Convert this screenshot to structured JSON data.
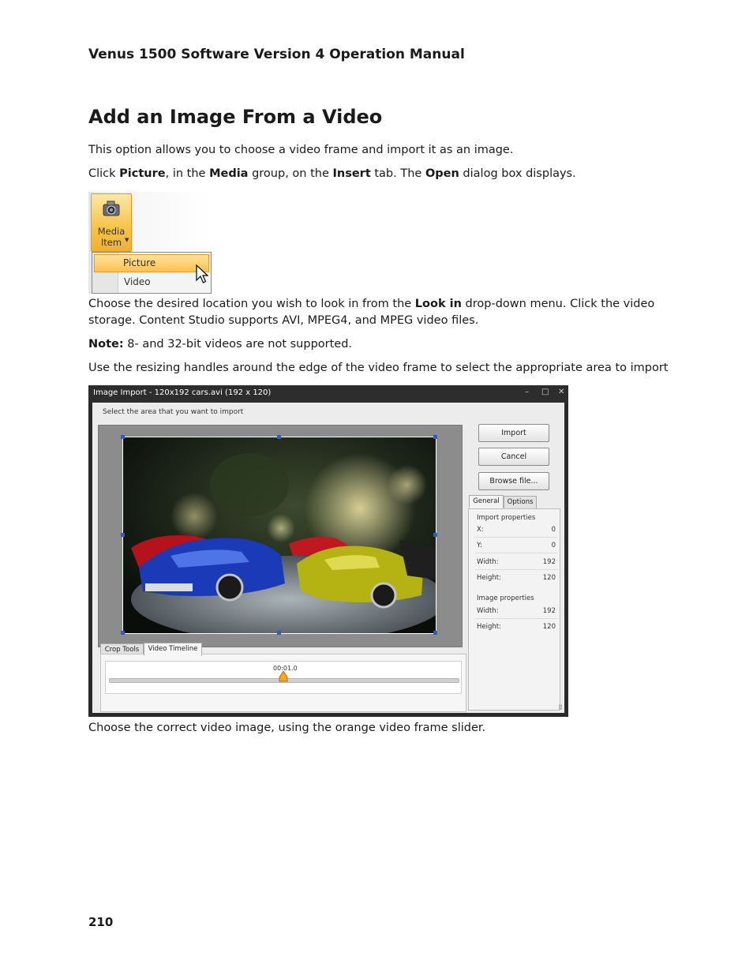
{
  "header": {
    "title": "Venus 1500 Software Version 4 Operation Manual"
  },
  "section": {
    "title": "Add an Image From a Video"
  },
  "body": {
    "p1": "This option allows you to choose a video frame and import it as an image.",
    "p2": {
      "t1": "Click ",
      "b1": "Picture",
      "t2": ", in the ",
      "b2": "Media",
      "t3": " group, on the ",
      "b3": "Insert",
      "t4": " tab. The ",
      "b4": "Open",
      "t5": " dialog box displays."
    },
    "p3": {
      "t1": "Choose the desired location you wish to look in from the ",
      "b1": "Look in",
      "t2": " drop-down menu. Click the video storage. Content Studio supports AVI, MPEG4, and MPEG video files."
    },
    "note": {
      "label": "Note:",
      "text": " 8- and 32-bit videos are not supported."
    },
    "p4": "Use the resizing handles around the edge of the video frame to select the appropriate area to import",
    "p5": "Choose the correct video image, using the orange video frame slider."
  },
  "menu_shot": {
    "button_label_1": "Media",
    "button_label_2": "Item",
    "items": [
      "Picture",
      "Video"
    ],
    "button_icon": "camera-icon"
  },
  "dialog": {
    "title": "Image Import - 120x192 cars.avi  (192 x 120)",
    "instruction": "Select the area that you want to import",
    "buttons": {
      "import": "Import",
      "cancel": "Cancel",
      "browse": "Browse file..."
    },
    "tabs": {
      "general": "General",
      "options": "Options"
    },
    "import_properties": {
      "title": "Import properties",
      "x_label": "X:",
      "x": "0",
      "y_label": "Y:",
      "y": "0",
      "width_label": "Width:",
      "width": "192",
      "height_label": "Height:",
      "height": "120"
    },
    "image_properties": {
      "title": "Image properties",
      "width_label": "Width:",
      "width": "192",
      "height_label": "Height:",
      "height": "120"
    },
    "bottom_tabs": {
      "crop": "Crop Tools",
      "timeline": "Video Timeline"
    },
    "timeline_time": "00:01.0",
    "timeline_position": 0.5
  },
  "footer": {
    "page_number": "210"
  }
}
